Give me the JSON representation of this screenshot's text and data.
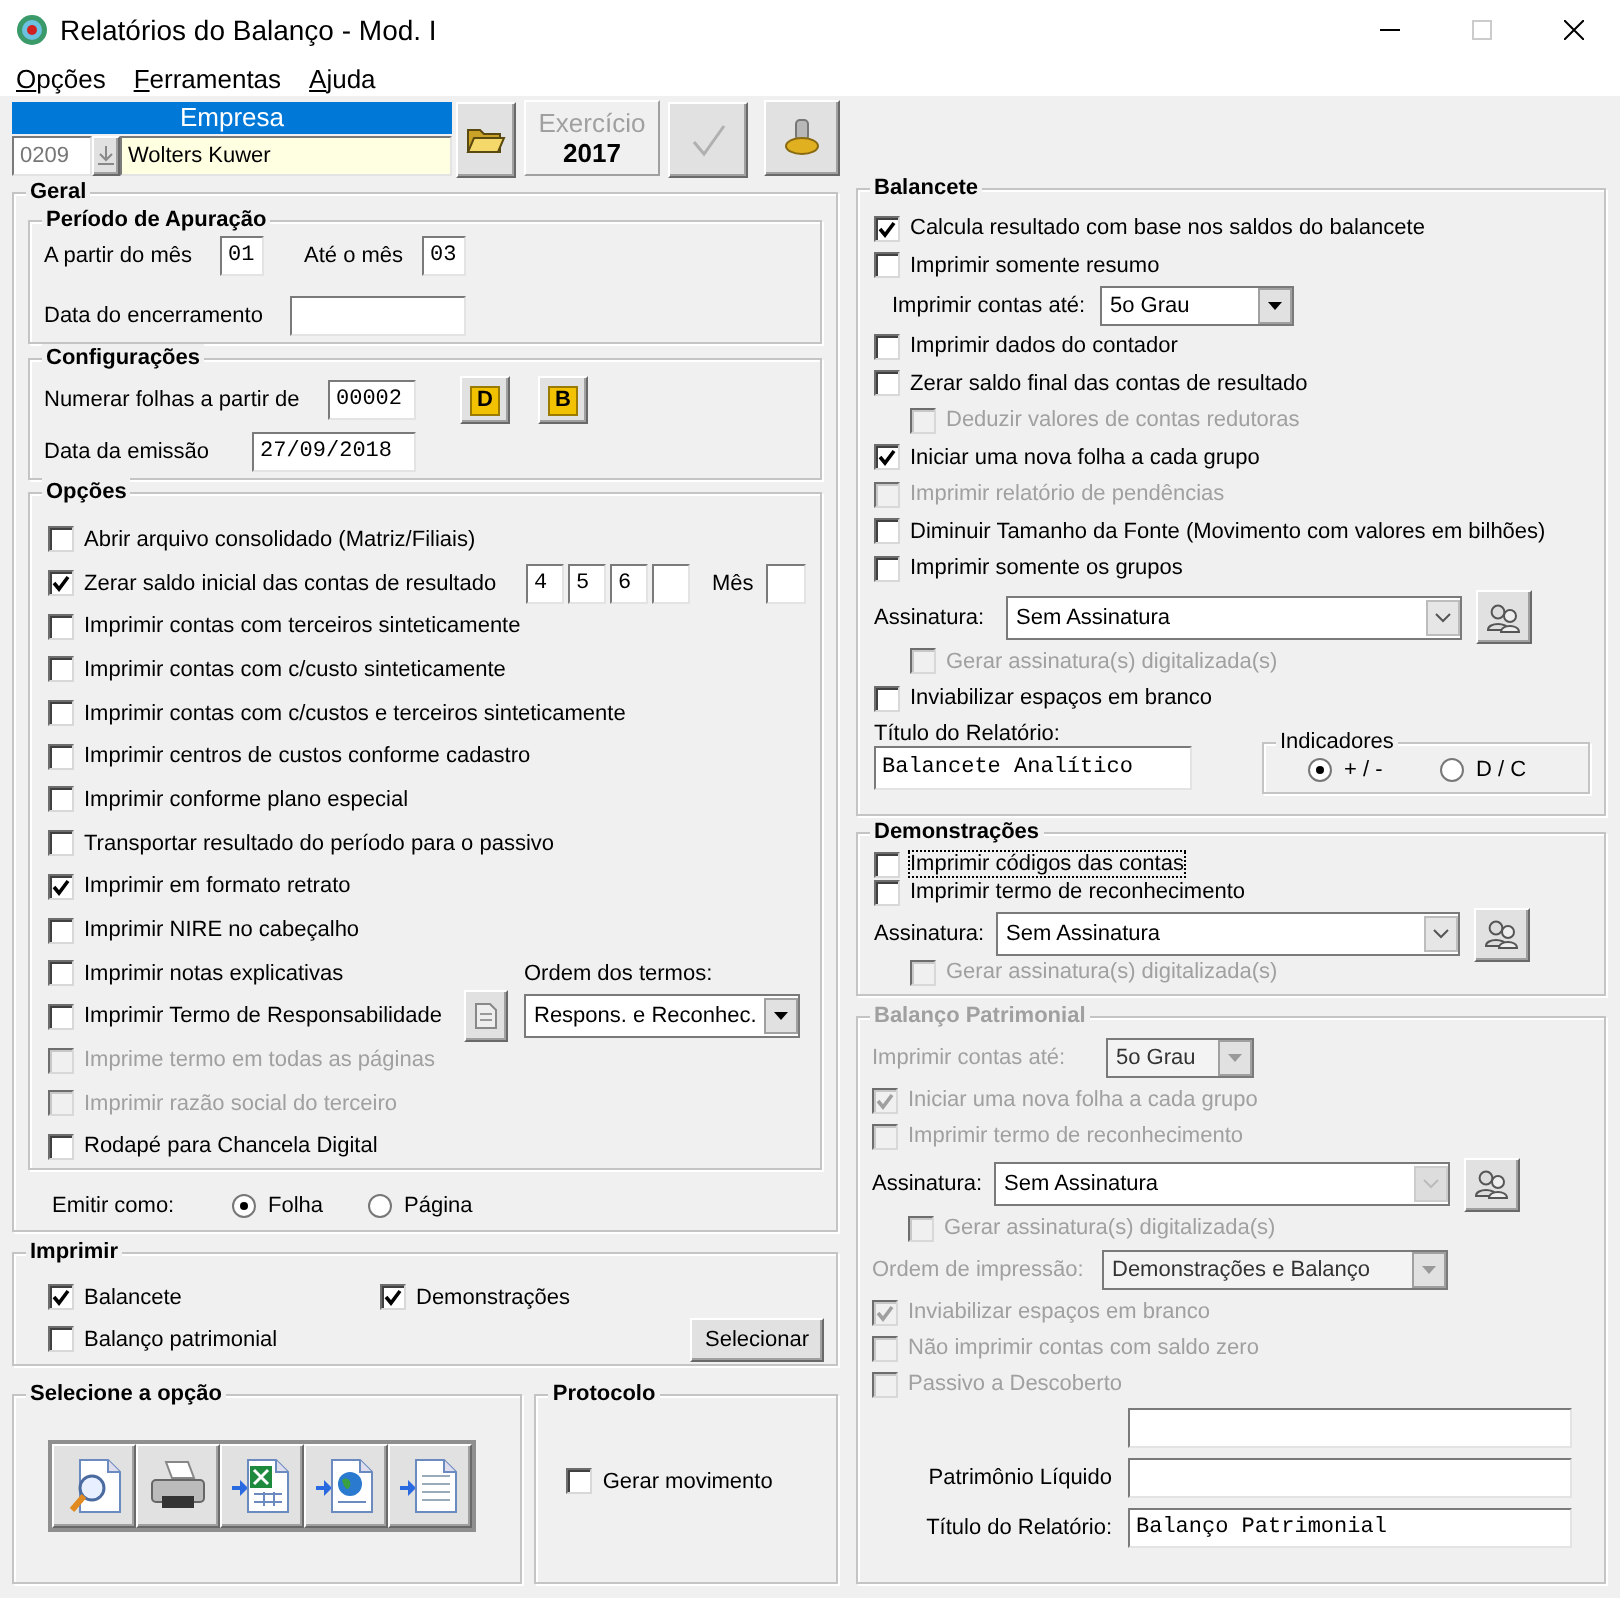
{
  "window": {
    "title": "Relatórios do Balanço - Mod. I"
  },
  "menu": [
    {
      "label": "Opções"
    },
    {
      "label": "Ferramentas"
    },
    {
      "label": "Ajuda"
    }
  ],
  "empresa": {
    "header": "Empresa",
    "code": "0209",
    "name": "Wolters Kuwer"
  },
  "exercicio": {
    "label": "Exercício",
    "year": "2017"
  },
  "confirm_button": {
    "disabled": true
  },
  "geral": {
    "title": "Geral",
    "periodo": {
      "title": "Período de Apuração",
      "from_label": "A partir do mês",
      "from": "01",
      "to_label": "Até o mês",
      "to": "03",
      "closing_label": "Data do encerramento"
    },
    "configuracoes": {
      "title": "Configurações",
      "numbering_label": "Numerar folhas a partir de",
      "numbering": "00002",
      "buttons": [
        "D",
        "B"
      ],
      "emission_label": "Data da emissão",
      "emission": "27/09/2018"
    },
    "opcoes": {
      "title": "Opções",
      "items": [
        {
          "kind": "check",
          "label": "Abrir arquivo consolidado (Matriz/Filiais)",
          "checked": false,
          "disabled": false
        },
        {
          "kind": "months",
          "label": "Zerar saldo inicial das contas de resultado",
          "checked": true,
          "disabled": false,
          "months": [
            "4",
            "5",
            "6"
          ],
          "month_label": "Mês"
        },
        {
          "kind": "check",
          "label": "Imprimir contas com terceiros sinteticamente",
          "checked": false,
          "disabled": false
        },
        {
          "kind": "check",
          "label": "Imprimir contas com c/custo sinteticamente",
          "checked": false,
          "disabled": false
        },
        {
          "kind": "check",
          "label": "Imprimir contas com c/custos e terceiros sinteticamente",
          "checked": false,
          "disabled": false
        },
        {
          "kind": "check",
          "label": "Imprimir centros de custos conforme cadastro",
          "checked": false,
          "disabled": false
        },
        {
          "kind": "check",
          "label": "Imprimir conforme plano especial",
          "checked": false,
          "disabled": false
        },
        {
          "kind": "check",
          "label": "Transportar resultado do período para o passivo",
          "checked": false,
          "disabled": false
        },
        {
          "kind": "check",
          "label": "Imprimir em formato retrato",
          "checked": true,
          "disabled": false
        },
        {
          "kind": "check",
          "label": "Imprimir NIRE no cabeçalho",
          "checked": false,
          "disabled": false
        },
        {
          "kind": "order_label",
          "label": "Imprimir notas explicativas",
          "checked": false,
          "disabled": false,
          "order_label": "Ordem dos termos:"
        },
        {
          "kind": "order_select",
          "label": "Imprimir Termo de Responsabilidade",
          "checked": false,
          "disabled": false,
          "order_value": "Respons. e Reconhec."
        },
        {
          "kind": "check",
          "label": "Imprime termo em todas as páginas",
          "checked": false,
          "disabled": true
        },
        {
          "kind": "check",
          "label": "Imprimir razão social do terceiro",
          "checked": false,
          "disabled": true
        },
        {
          "kind": "check",
          "label": "Rodapé para Chancela Digital",
          "checked": false,
          "disabled": false
        }
      ]
    },
    "emit": {
      "label": "Emitir como:",
      "options": [
        {
          "label": "Folha",
          "selected": true
        },
        {
          "label": "Página",
          "selected": false
        }
      ]
    }
  },
  "imprimir": {
    "title": "Imprimir",
    "items": [
      {
        "label": "Balancete",
        "checked": true
      },
      {
        "label": "Demonstrações",
        "checked": true
      },
      {
        "label": "Balanço patrimonial",
        "checked": false
      }
    ],
    "button": "Selecionar"
  },
  "selecione": {
    "title": "Selecione a opção",
    "buttons": [
      {
        "kind": "preview"
      },
      {
        "kind": "print"
      },
      {
        "kind": "spreadsheet"
      },
      {
        "kind": "web"
      },
      {
        "kind": "text"
      }
    ]
  },
  "protocolo": {
    "title": "Protocolo",
    "items": [
      {
        "label": "Gerar movimento",
        "checked": false
      }
    ]
  },
  "balancete": {
    "title": "Balancete",
    "disabled": false,
    "items": [
      {
        "kind": "check",
        "label": "Calcula resultado com base nos saldos do balancete",
        "checked": true,
        "disabled": false
      },
      {
        "kind": "check",
        "label": "Imprimir somente resumo",
        "checked": false,
        "disabled": false
      },
      {
        "kind": "select",
        "label": "Imprimir contas até:",
        "value": "5o Grau",
        "disabled": false
      },
      {
        "kind": "check",
        "label": "Imprimir dados do contador",
        "checked": false,
        "disabled": false
      },
      {
        "kind": "check",
        "label": "Zerar saldo final das contas de resultado",
        "checked": false,
        "disabled": false
      },
      {
        "kind": "subcheck",
        "label": "Deduzir valores de contas redutoras",
        "checked": false,
        "disabled": true
      },
      {
        "kind": "check",
        "label": "Iniciar uma nova folha a cada grupo",
        "checked": true,
        "disabled": false
      },
      {
        "kind": "check",
        "label": "Imprimir relatório de pendências",
        "checked": false,
        "disabled": true
      },
      {
        "kind": "check",
        "label": "Diminuir Tamanho da Fonte (Movimento com valores em bilhões)",
        "checked": false,
        "disabled": false
      },
      {
        "kind": "check",
        "label": "Imprimir somente os grupos",
        "checked": false,
        "disabled": false
      },
      {
        "kind": "signature",
        "label": "Assinatura:",
        "value": "Sem Assinatura",
        "disabled": false
      },
      {
        "kind": "subcheck",
        "label": "Gerar assinatura(s) digitalizada(s)",
        "checked": false,
        "disabled": true
      },
      {
        "kind": "check",
        "label": "Inviabilizar espaços em branco",
        "checked": false,
        "disabled": false
      }
    ],
    "report_title": {
      "label": "Título do Relatório:",
      "value": "Balancete Analítico"
    },
    "indicators": {
      "title": "Indicadores",
      "options": [
        {
          "label": "+ / -",
          "selected": true
        },
        {
          "label": "D / C",
          "selected": false
        }
      ]
    }
  },
  "demonstracoes": {
    "title": "Demonstrações",
    "disabled": false,
    "items": [
      {
        "kind": "check",
        "label": "Imprimir códigos das contas",
        "checked": false,
        "disabled": false,
        "focused": true
      },
      {
        "kind": "check",
        "label": "Imprimir termo de reconhecimento",
        "checked": false,
        "disabled": false,
        "focused": false
      },
      {
        "kind": "signature",
        "label": "Assinatura:",
        "value": "Sem Assinatura",
        "disabled": false
      },
      {
        "kind": "subcheck",
        "label": "Gerar assinatura(s) digitalizada(s)",
        "checked": false,
        "disabled": true,
        "focused": false
      }
    ]
  },
  "balanco": {
    "title": "Balanço Patrimonial",
    "disabled": true,
    "items": [
      {
        "kind": "select",
        "label": "Imprimir contas até:",
        "value": "5o Grau",
        "disabled": true
      },
      {
        "kind": "check",
        "label": "Iniciar uma nova folha a cada grupo",
        "checked": true,
        "disabled": true
      },
      {
        "kind": "check",
        "label": "Imprimir termo de reconhecimento",
        "checked": false,
        "disabled": true
      },
      {
        "kind": "signature",
        "label": "Assinatura:",
        "value": "Sem Assinatura",
        "disabled": true
      },
      {
        "kind": "subcheck",
        "label": "Gerar assinatura(s) digitalizada(s)",
        "checked": false,
        "disabled": true
      },
      {
        "kind": "select",
        "label": "Ordem de impressão:",
        "value": "Demonstrações e Balanço",
        "disabled": true
      },
      {
        "kind": "check",
        "label": "Inviabilizar espaços em branco",
        "checked": true,
        "disabled": true
      },
      {
        "kind": "check",
        "label": "Não imprimir contas com saldo zero",
        "checked": false,
        "disabled": true
      },
      {
        "kind": "check",
        "label": "Passivo a Descoberto",
        "checked": false,
        "disabled": true
      },
      {
        "kind": "field"
      },
      {
        "kind": "field",
        "label": "Patrimônio Líquido"
      },
      {
        "kind": "field",
        "label": "Título do Relatório:",
        "value": "Balanço Patrimonial"
      }
    ]
  }
}
